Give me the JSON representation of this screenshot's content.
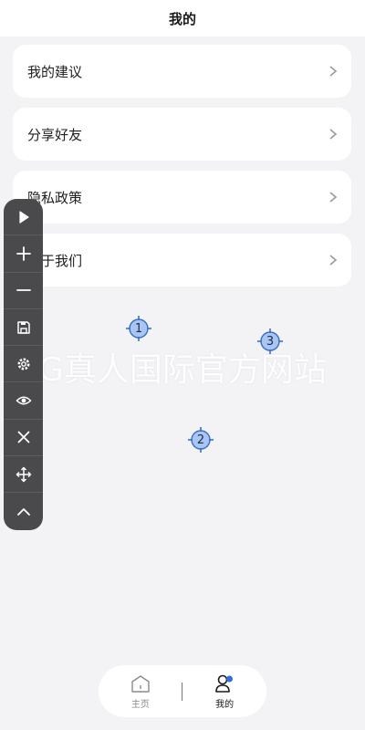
{
  "header": {
    "title": "我的"
  },
  "menu": [
    {
      "label": "我的建议"
    },
    {
      "label": "分享好友"
    },
    {
      "label": "隐私政策"
    },
    {
      "label": "关于我们"
    }
  ],
  "toolbar": {
    "buttons": [
      "play-icon",
      "plus-icon",
      "minus-icon",
      "save-icon",
      "settings-icon",
      "eye-icon",
      "close-icon",
      "move-icon",
      "chevron-up-icon"
    ]
  },
  "targets": [
    {
      "number": "1"
    },
    {
      "number": "2"
    },
    {
      "number": "3"
    }
  ],
  "watermark": "AG真人国际官方网站",
  "nav": {
    "home_label": "主页",
    "mine_label": "我的",
    "active_color": "#1a1a1a",
    "inactive_color": "#8a8a8a",
    "accent_dot": "#2f6fe0"
  }
}
